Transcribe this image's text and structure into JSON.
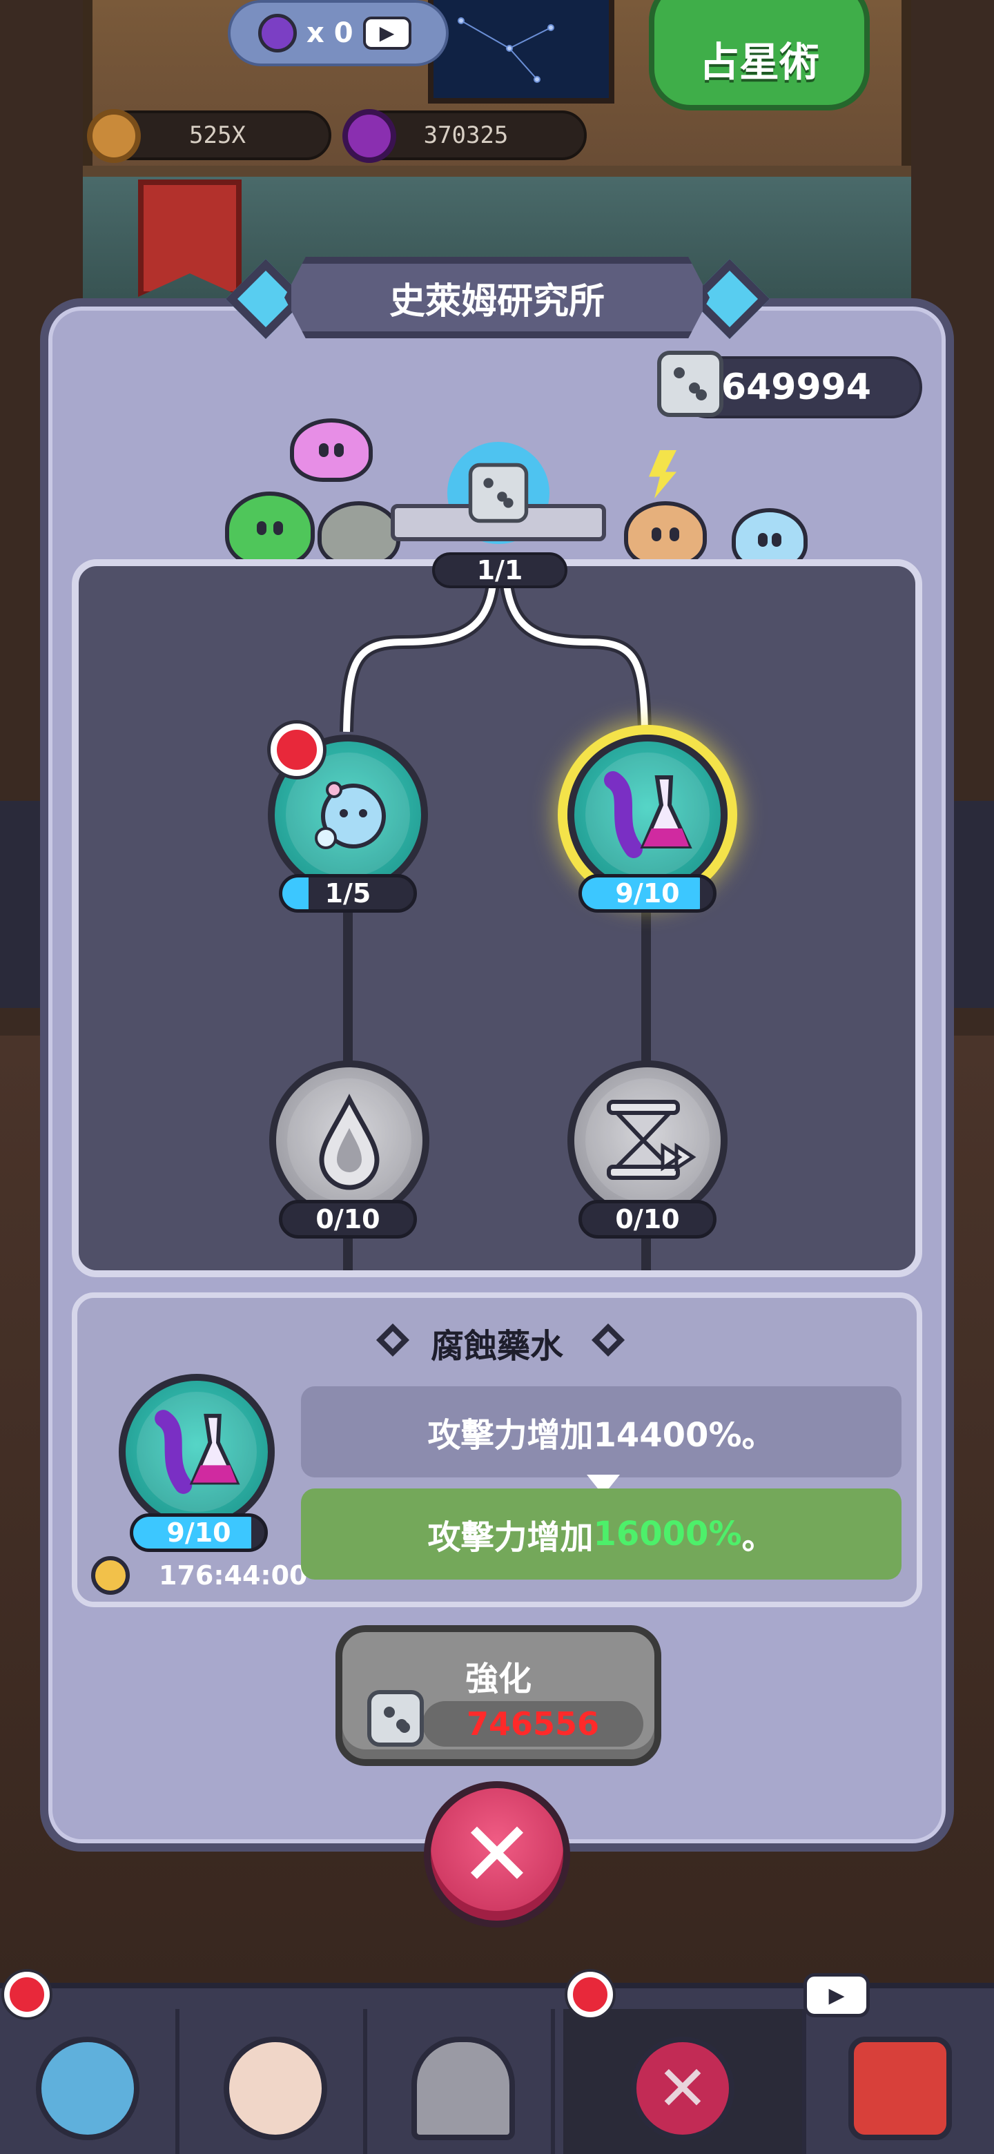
{
  "top_bar": {
    "video_count_label": "x 0",
    "astrology_button_label": "占星術",
    "multiplier": "525X",
    "gem_count": "370325"
  },
  "modal": {
    "title": "史萊姆研究所",
    "dice_count": "649994",
    "root_node": {
      "level": "1/1",
      "progress": 1.0
    }
  },
  "skill_tree": {
    "nodes": [
      {
        "name": "bubble-slime-skill",
        "level": "1/5",
        "progress": 0.2,
        "has_alert": true,
        "icon": "bubble-slime-icon"
      },
      {
        "name": "corrosion-potion-skill",
        "level": "9/10",
        "progress": 0.9,
        "selected": true,
        "icon": "potion-flask-icon"
      },
      {
        "name": "drop-skill",
        "level": "0/10",
        "progress": 0.0,
        "locked": true,
        "icon": "water-drop-icon"
      },
      {
        "name": "fast-forward-skill",
        "level": "0/10",
        "progress": 0.0,
        "locked": true,
        "icon": "hourglass-fast-forward-icon"
      }
    ]
  },
  "detail": {
    "title": "腐蝕藥水",
    "level": "9/10",
    "progress": 0.9,
    "timer": "176:44:00",
    "current_effect": "攻擊力增加14400%。",
    "next_effect_prefix": "攻擊力增加",
    "next_effect_value": "16000%",
    "next_effect_suffix": "。"
  },
  "upgrade": {
    "label": "強化",
    "cost": "746556"
  },
  "colors": {
    "accent_blue": "#3cc7ff",
    "cost_red": "#ff2a2a",
    "next_value_green": "#4df06a",
    "close_pink": "#e04a72"
  },
  "bottom_nav": {
    "items": [
      {
        "icon": "slime-face-icon",
        "has_alert": true
      },
      {
        "icon": "chicken-icon"
      },
      {
        "icon": "portal-gate-icon"
      },
      {
        "icon": "close-icon",
        "active": true,
        "has_alert": true
      },
      {
        "icon": "shop-icon",
        "has_video": true
      }
    ]
  }
}
